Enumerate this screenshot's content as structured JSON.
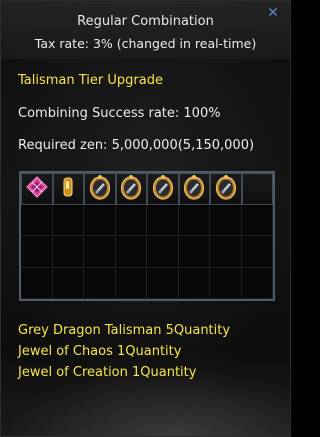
{
  "window": {
    "title": "Regular Combination",
    "tax_text": "Tax rate: 3% (changed in real-time)",
    "close_glyph": "✕"
  },
  "info": {
    "combination_name": "Talisman Tier Upgrade",
    "success_rate": "Combining Success rate: 100%",
    "required_zen": "Required zen: 5,000,000(5,150,000)"
  },
  "grid": {
    "columns": 8,
    "rows": 4,
    "items": [
      {
        "slot": 0,
        "icon": "jewel-of-chaos-icon"
      },
      {
        "slot": 1,
        "icon": "jewel-of-creation-icon"
      },
      {
        "slot": 2,
        "icon": "grey-dragon-talisman-icon"
      },
      {
        "slot": 3,
        "icon": "grey-dragon-talisman-icon"
      },
      {
        "slot": 4,
        "icon": "grey-dragon-talisman-icon"
      },
      {
        "slot": 5,
        "icon": "grey-dragon-talisman-icon"
      },
      {
        "slot": 6,
        "icon": "grey-dragon-talisman-icon"
      }
    ]
  },
  "requirements": [
    "Grey Dragon Talisman 5Quantity",
    "Jewel of Chaos 1Quantity",
    "Jewel of Creation 1Quantity"
  ],
  "colors": {
    "highlight_text": "#f6e64d",
    "normal_text": "#ececec",
    "close_icon": "#5f83c7",
    "grid_border": "#4f5a6a"
  }
}
